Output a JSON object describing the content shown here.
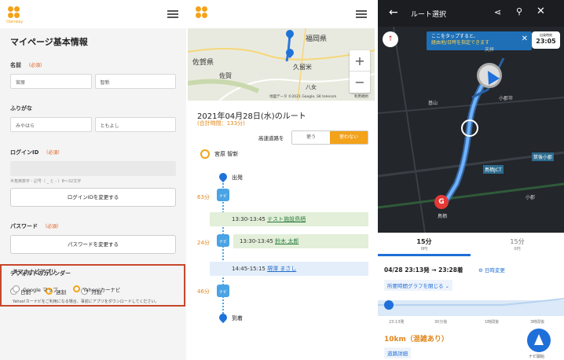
{
  "panel1": {
    "logo_text": "Ownway",
    "title": "マイページ基本情報",
    "name_label": "名前",
    "required": "（必須）",
    "last_name": "宮原",
    "first_name": "智新",
    "kana_label": "ふりがな",
    "kana_last": "みやはら",
    "kana_first": "ともよし",
    "login_label": "ログインID",
    "login_hint": "半角英数字・記号（ _ と - ）8〜32文字",
    "login_button": "ログインIDを変更する",
    "password_label": "パスワード",
    "password_button": "パスワードを変更する",
    "calendar_label": "デフォルトのカレンダー",
    "calendar_options": [
      "日割",
      "週割",
      "月割"
    ],
    "calendar_selected": "週割",
    "nav_label": "スマホナビアプリ",
    "nav_options": [
      "Google マップ",
      "Yahoo!カーナビ"
    ],
    "nav_selected": "Yahoo!カーナビ",
    "nav_note": "Yahoo!カーナビをご利用になる場合、事前にアプリをダウンロードしてください。"
  },
  "panel2": {
    "map_labels": [
      "福岡県",
      "佐賀県",
      "久留米",
      "佐賀",
      "八女"
    ],
    "map_footer": "地図データ ©2021 Google, SK telecom",
    "map_terms": "利用規約",
    "zoom_in": "+",
    "zoom_out": "−",
    "route_title": "2021年04月28日(水)のルート",
    "total_time": "(合計時間：133分)",
    "highway_label": "高速道路を",
    "highway_use": "使う",
    "highway_no": "使わない",
    "user_name": "宮原 智新",
    "start": "出発",
    "end": "到着",
    "nav_tag": "ナビ",
    "durations": [
      "63分",
      "24分",
      "46分"
    ],
    "stops": [
      {
        "num": "1",
        "time": "13:30-13:45",
        "name": "テスト施設鳥栖"
      },
      {
        "num": "",
        "time": "13:30-13:45",
        "name": "鈴木 太郎"
      },
      {
        "num": "2",
        "time": "14:45-15:15",
        "name": "堺澤 まさし"
      }
    ]
  },
  "panel3": {
    "title": "ルート選択",
    "tooltip_line1": "ここをタップすると、",
    "tooltip_line2": "経由地/日時を指定できます",
    "time_label": "出発時刻",
    "time": "23:05",
    "map_labels": [
      "天拝",
      "小郡市",
      "鳥栖JCT",
      "筑後小郡",
      "鳥栖",
      "小郡",
      "基山"
    ],
    "tab1_time": "15分",
    "tab1_fee": "0円",
    "tab2_time": "15分",
    "tab2_fee": "0円",
    "date_route": "04/28 23:13発 → 23:28着",
    "change_date": "日時変更",
    "graph_toggle": "所要時間グラフを閉じる",
    "graph_ticks": [
      "23:13発",
      "30分後",
      "1時間後",
      "3時間後"
    ],
    "distance": "10km（混雑あり）",
    "route_detail": "道路詳細",
    "nav_start": "ナビ開始"
  }
}
